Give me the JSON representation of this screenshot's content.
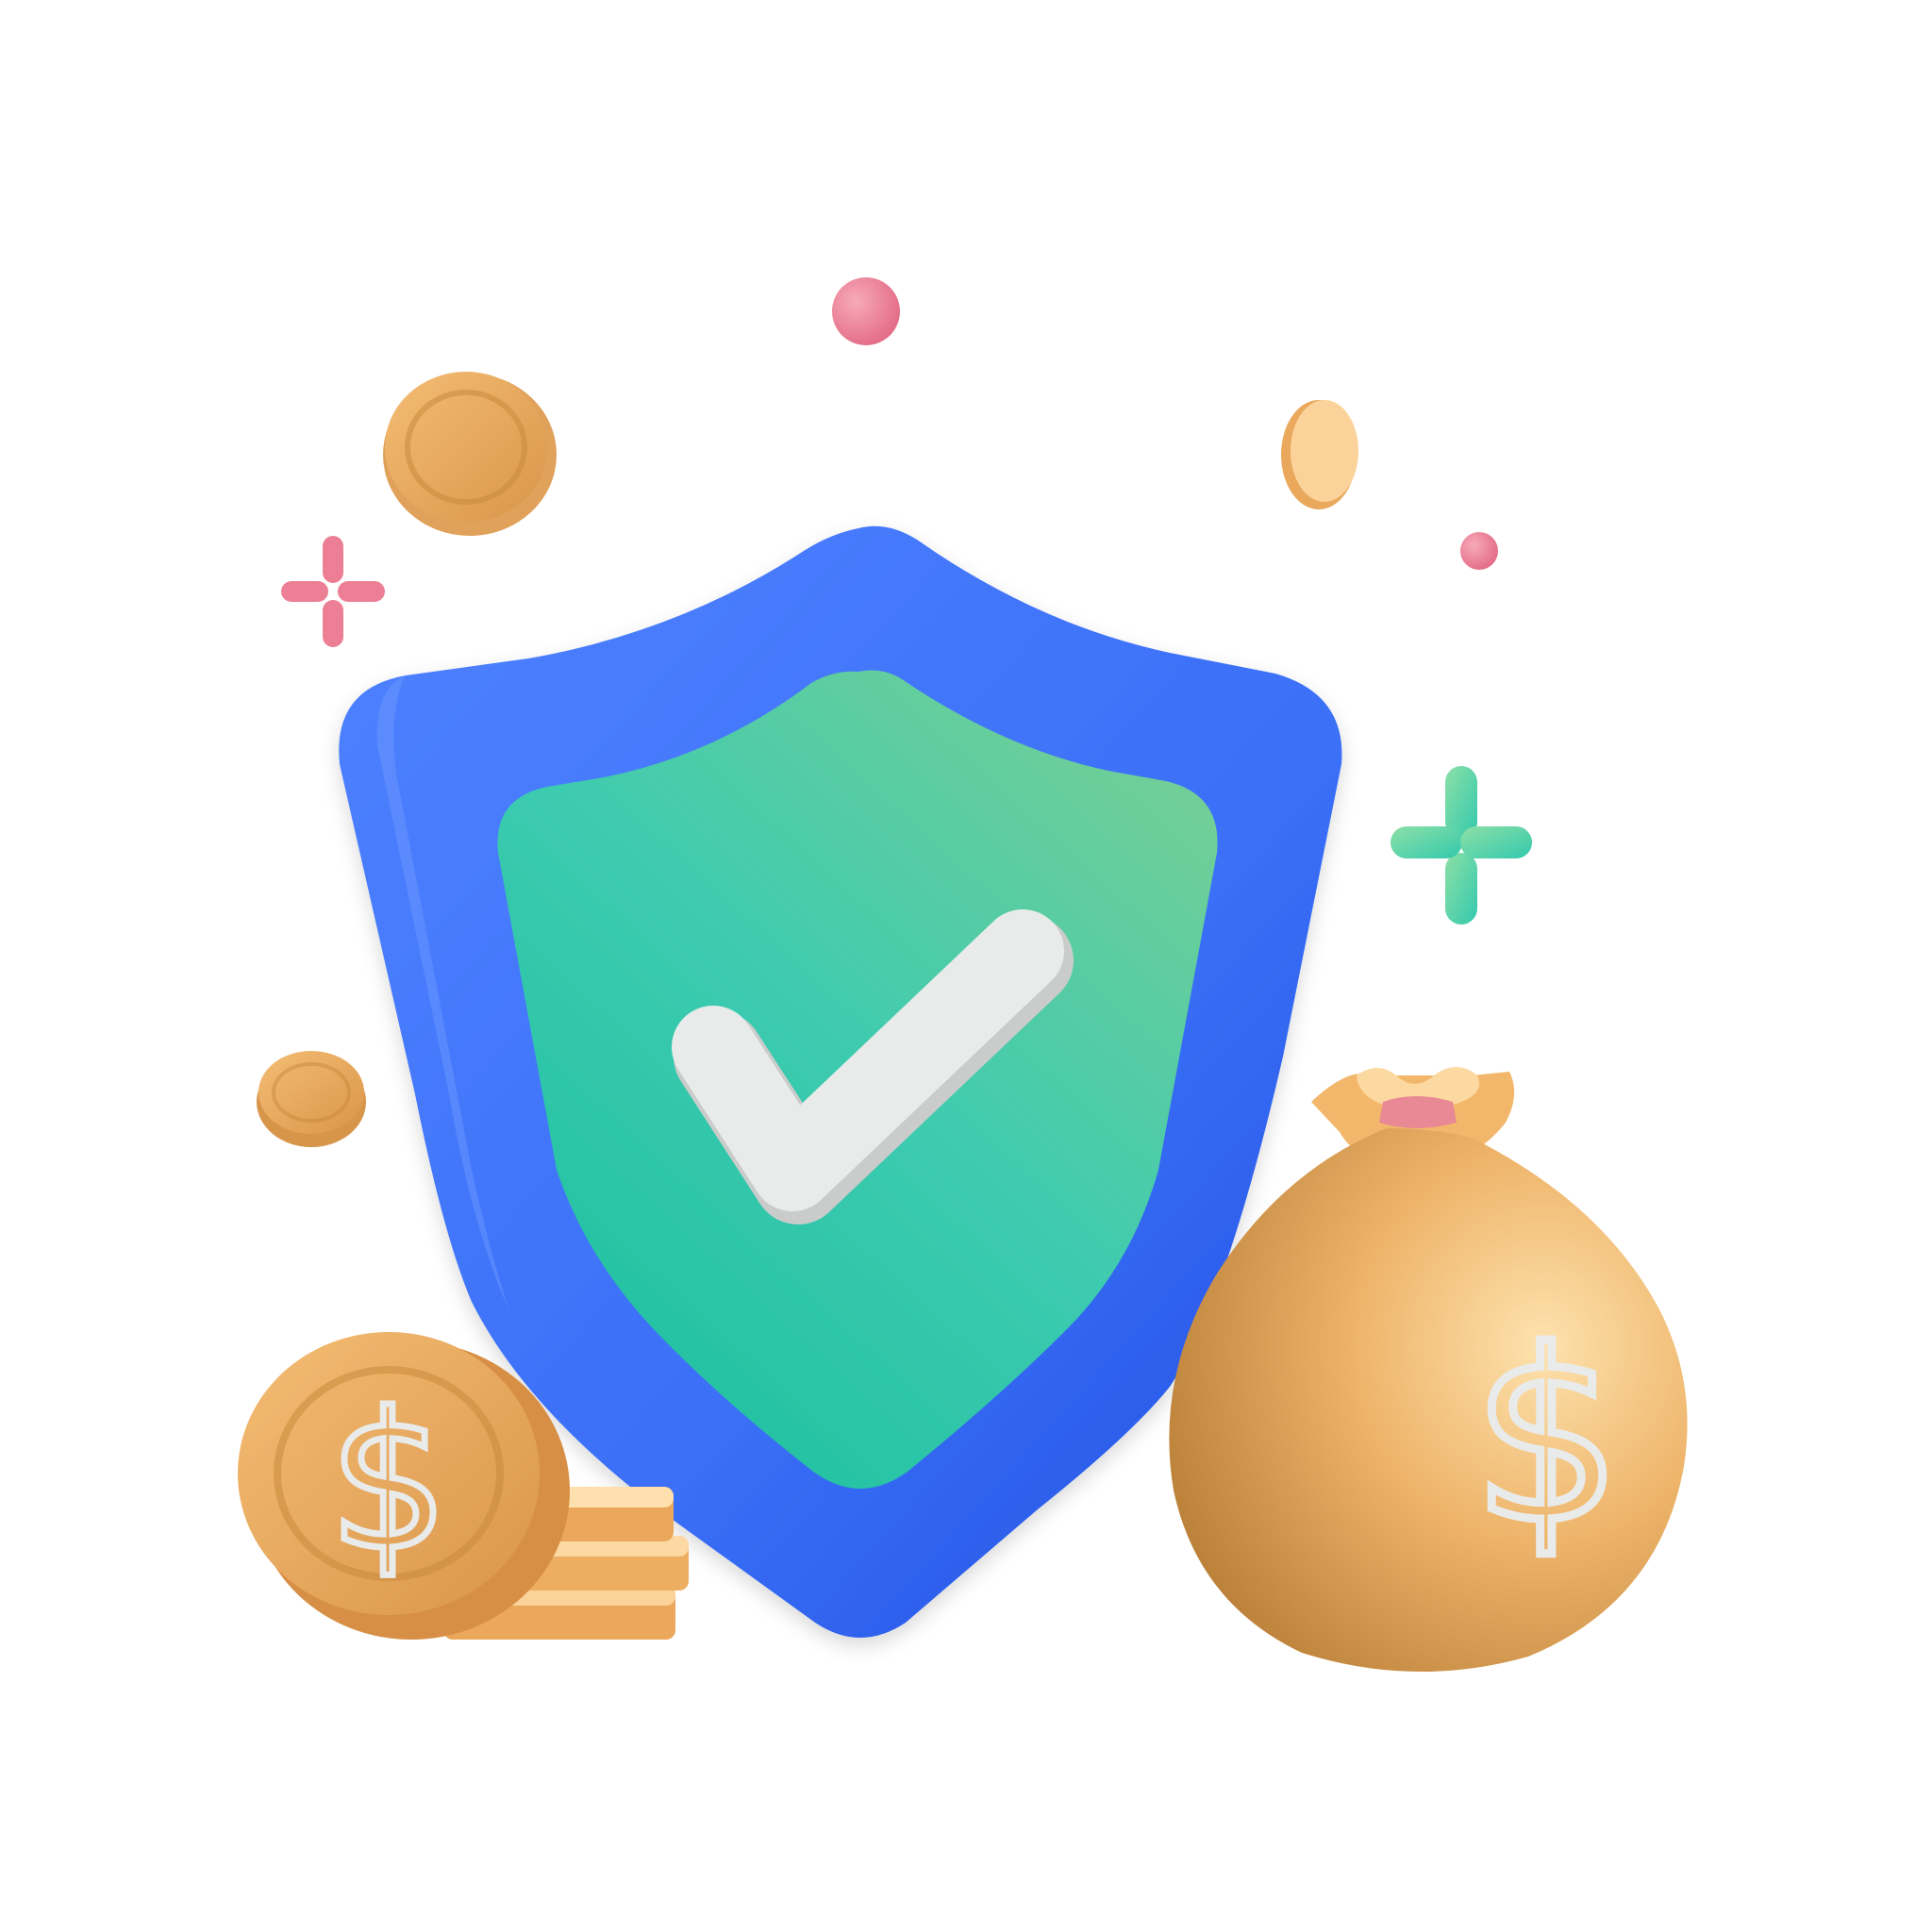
{
  "illustration": {
    "subject": "security-shield-with-money",
    "elements": {
      "shield_icon": "shield-check-icon",
      "checkmark_icon": "checkmark-icon",
      "money_bag_icon": "money-bag-icon",
      "coin_stack_icon": "coin-stack-icon",
      "sparkle_icon": "sparkle-icon"
    },
    "coin_symbol": "$",
    "bag_symbol": "$"
  },
  "colors": {
    "background": "#ffffff",
    "shield_outer": "#3a6ff7",
    "shield_outer_dark": "#1f4fe0",
    "shield_inner_top": "#7acf96",
    "shield_inner_bottom": "#1fc3a8",
    "checkmark": "#e6e8e6",
    "coin": "#e8a95c",
    "coin_light": "#f7c98a",
    "coin_dark": "#c98a3c",
    "bag": "#f0b467",
    "bag_dark": "#b9803a",
    "bag_light": "#fde0a8",
    "bag_tie": "#e98995",
    "sparkle_pink": "#ec7f95",
    "sparkle_green": "#4fd1a7",
    "dot_pink": "#ec7f95",
    "dollar_sign": "#e9ebea"
  }
}
